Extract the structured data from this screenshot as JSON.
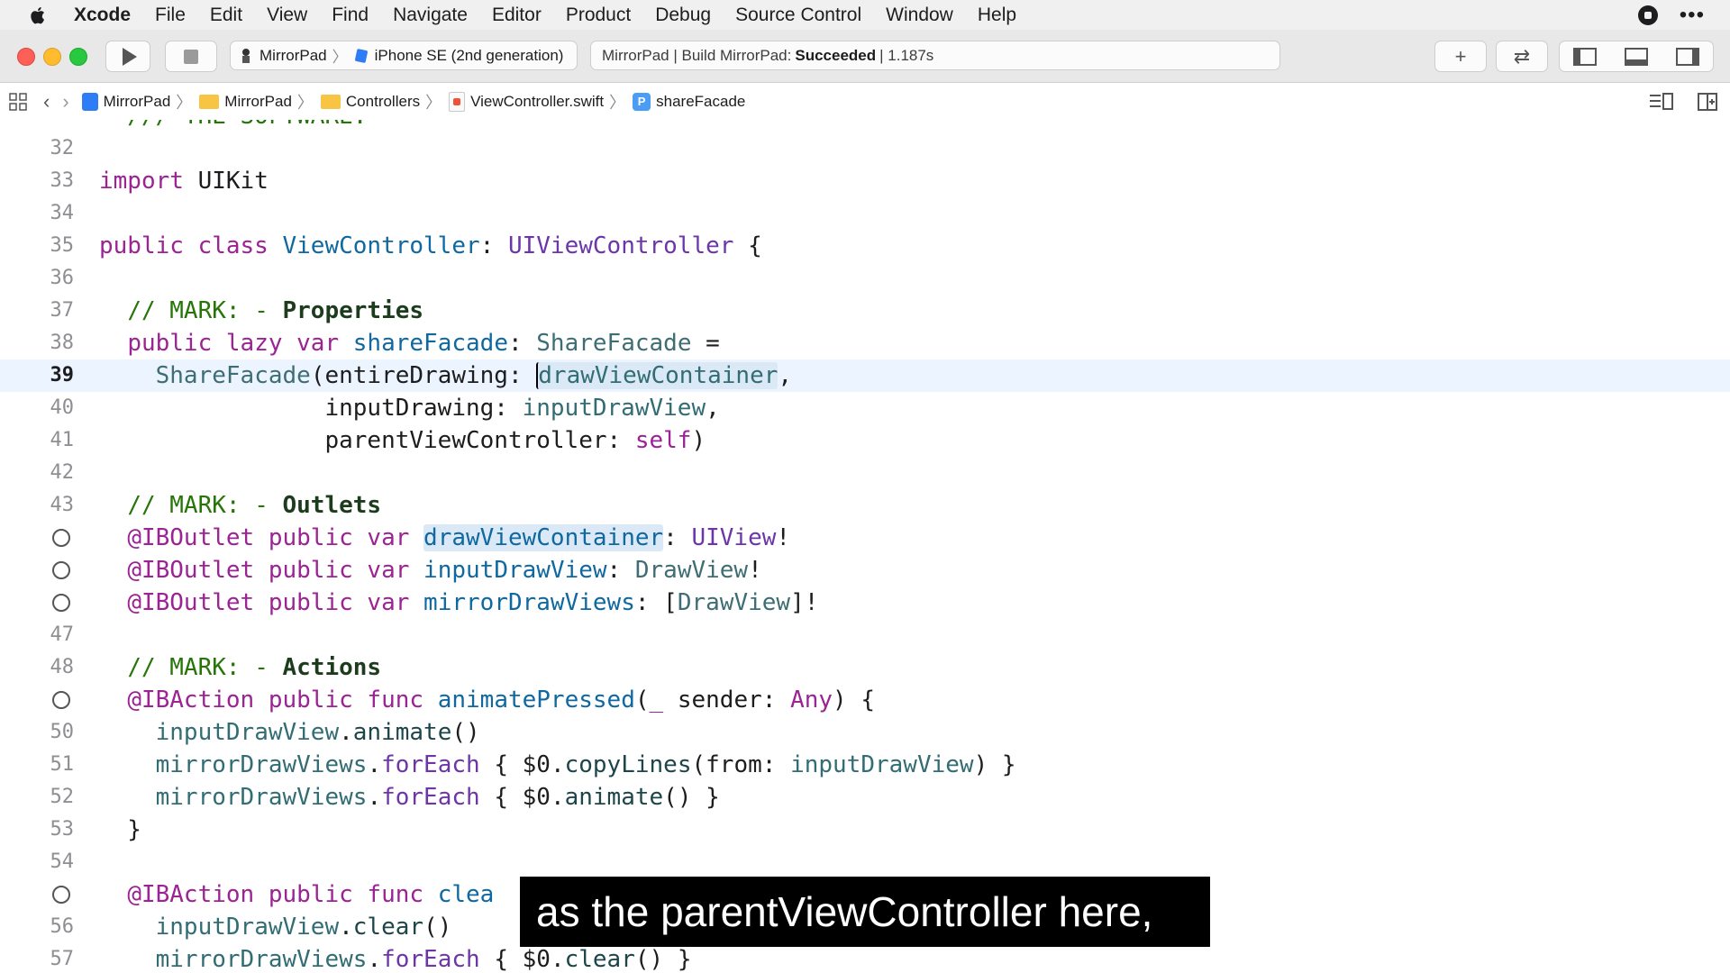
{
  "menubar": {
    "app": "Xcode",
    "items": [
      "File",
      "Edit",
      "View",
      "Find",
      "Navigate",
      "Editor",
      "Product",
      "Debug",
      "Source Control",
      "Window",
      "Help"
    ],
    "more": "•••"
  },
  "toolbar": {
    "scheme": "MirrorPad",
    "device": "iPhone SE (2nd generation)",
    "status_prefix": "MirrorPad | Build MirrorPad:",
    "status_result": "Succeeded",
    "status_time": "| 1.187s",
    "add_glyph": "+",
    "swap_glyph": "⇄"
  },
  "jumpbar": {
    "crumbs": [
      "MirrorPad",
      "MirrorPad",
      "Controllers",
      "ViewController.swift",
      "shareFacade"
    ],
    "prop_badge": "P",
    "sep": "〉"
  },
  "editor": {
    "lines": [
      {
        "n": "32",
        "text": ""
      },
      {
        "n": "33",
        "text": "import UIKit"
      },
      {
        "n": "34",
        "text": ""
      },
      {
        "n": "35",
        "text": "public class ViewController: UIViewController {"
      },
      {
        "n": "36",
        "text": ""
      },
      {
        "n": "37",
        "text": "  // MARK: - Properties"
      },
      {
        "n": "38",
        "text": "  public lazy var shareFacade: ShareFacade ="
      },
      {
        "n": "39",
        "text": "    ShareFacade(entireDrawing: drawViewContainer,"
      },
      {
        "n": "40",
        "text": "                inputDrawing: inputDrawView,"
      },
      {
        "n": "41",
        "text": "                parentViewController: self)"
      },
      {
        "n": "42",
        "text": ""
      },
      {
        "n": "43",
        "text": "  // MARK: - Outlets"
      },
      {
        "n": "",
        "text": "  @IBOutlet public var drawViewContainer: UIView!"
      },
      {
        "n": "",
        "text": "  @IBOutlet public var inputDrawView: DrawView!"
      },
      {
        "n": "",
        "text": "  @IBOutlet public var mirrorDrawViews: [DrawView]!"
      },
      {
        "n": "47",
        "text": ""
      },
      {
        "n": "48",
        "text": "  // MARK: - Actions"
      },
      {
        "n": "",
        "text": "  @IBAction public func animatePressed(_ sender: Any) {"
      },
      {
        "n": "50",
        "text": "    inputDrawView.animate()"
      },
      {
        "n": "51",
        "text": "    mirrorDrawViews.forEach { $0.copyLines(from: inputDrawView) }"
      },
      {
        "n": "52",
        "text": "    mirrorDrawViews.forEach { $0.animate() }"
      },
      {
        "n": "53",
        "text": "  }"
      },
      {
        "n": "54",
        "text": ""
      },
      {
        "n": "",
        "text": "  @IBAction public func clea"
      },
      {
        "n": "56",
        "text": "    inputDrawView.clear()"
      },
      {
        "n": "57",
        "text": "    mirrorDrawViews.forEach { $0.clear() }"
      }
    ],
    "current_line": "39"
  },
  "caption": "as the parentViewController here,",
  "colors": {
    "keyword": "#9b2393",
    "type": "#1c464a",
    "comment": "#267507",
    "current_line_bg": "#ecf5ff"
  }
}
